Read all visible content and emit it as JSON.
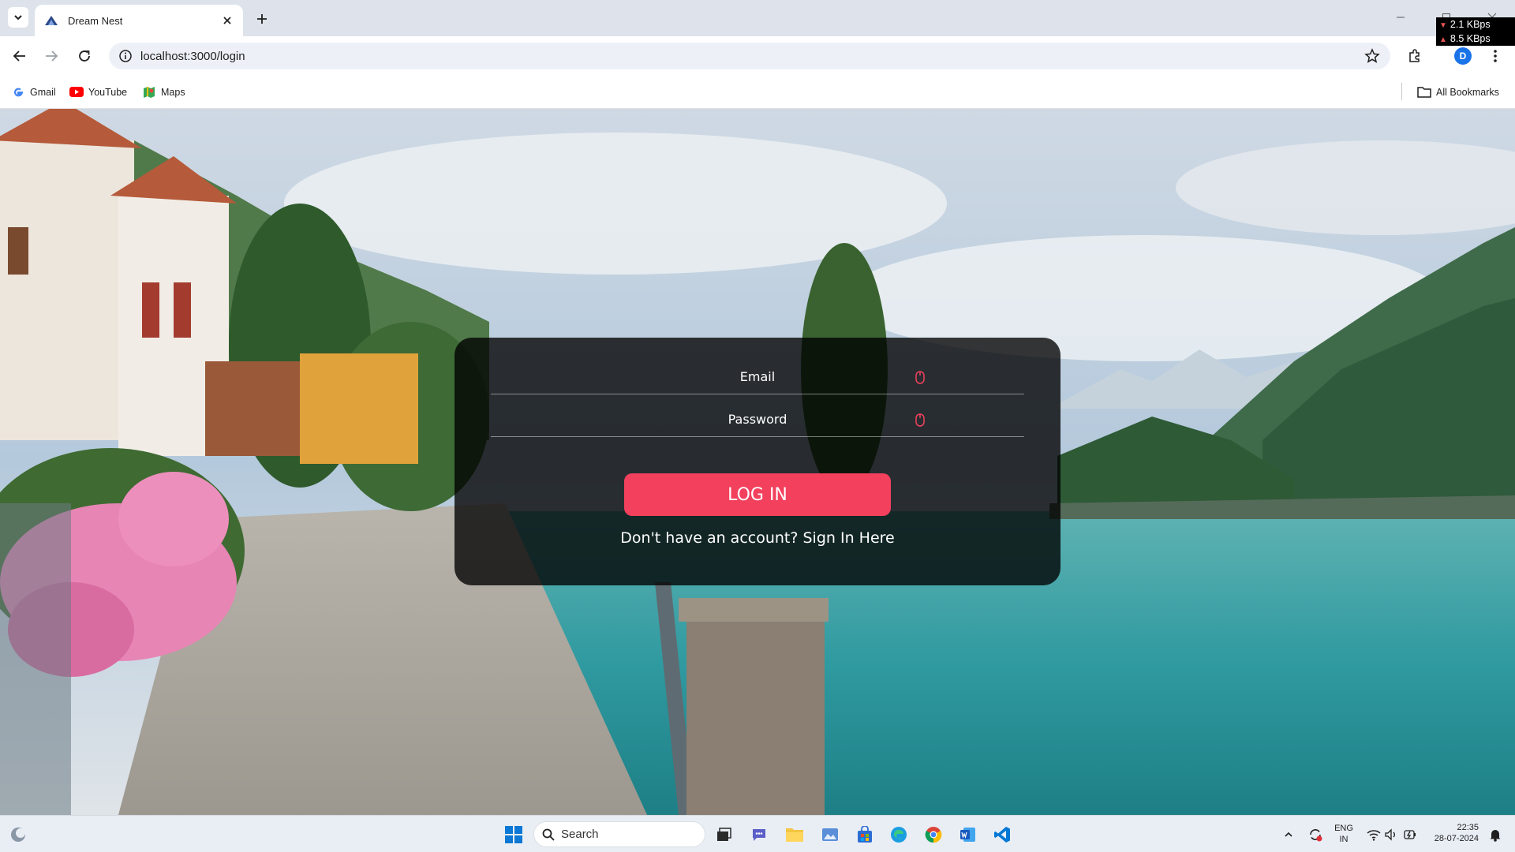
{
  "browser": {
    "tab": {
      "title": "Dream Nest"
    },
    "url": "localhost:3000/login",
    "profile_initial": "D",
    "bookmarks": [
      {
        "label": "Gmail",
        "icon": "google-icon"
      },
      {
        "label": "YouTube",
        "icon": "youtube-icon"
      },
      {
        "label": "Maps",
        "icon": "maps-icon"
      }
    ],
    "all_bookmarks_label": "All Bookmarks"
  },
  "netspeed": {
    "download": "2.1 KBps",
    "upload": "8.5 KBps"
  },
  "login": {
    "email_placeholder": "Email",
    "password_placeholder": "Password",
    "login_button": "LOG IN",
    "signup_link": "Don't have an account? Sign In Here"
  },
  "taskbar": {
    "search_placeholder": "Search",
    "language": "ENG",
    "region": "IN",
    "time": "22:35",
    "date": "28-07-2024"
  },
  "colors": {
    "accent": "#f2405d",
    "card_background": "rgba(0,0,0,0.78)",
    "chrome_tabbar": "#dee3eb"
  }
}
